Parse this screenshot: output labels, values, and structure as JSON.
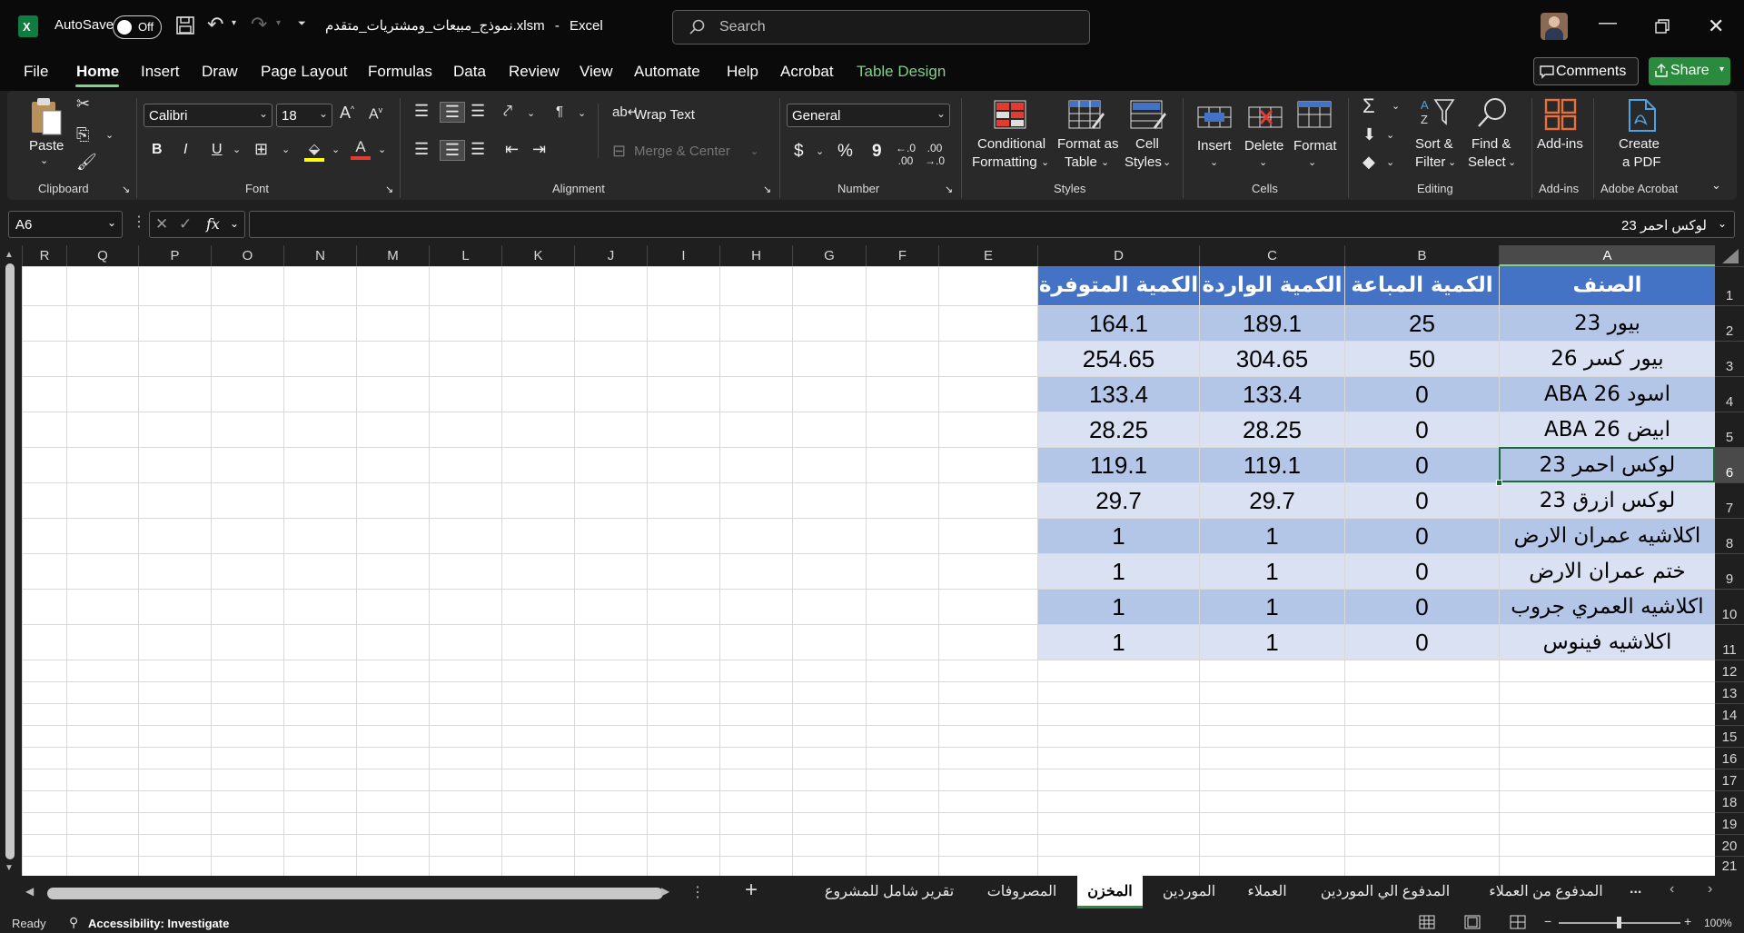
{
  "titlebar": {
    "autosave_label": "AutoSave",
    "autosave_state": "Off",
    "file_title": "نموذج_مبيعات_ومشتريات_متقدم.xlsm",
    "app_name": "Excel",
    "title_separator": "-",
    "search_placeholder": "Search"
  },
  "menu": {
    "items": [
      "File",
      "Home",
      "Insert",
      "Draw",
      "Page Layout",
      "Formulas",
      "Data",
      "Review",
      "View",
      "Automate",
      "Help",
      "Acrobat",
      "Table Design"
    ],
    "active": "Home",
    "comments_label": "Comments",
    "share_label": "Share"
  },
  "ribbon": {
    "clipboard": {
      "paste": "Paste",
      "group": "Clipboard"
    },
    "font": {
      "name": "Calibri",
      "size": "18",
      "bold": "B",
      "italic": "I",
      "underline": "U",
      "group": "Font"
    },
    "alignment": {
      "wrap": "Wrap Text",
      "merge": "Merge & Center",
      "group": "Alignment"
    },
    "number": {
      "format": "General",
      "currency": "$",
      "percent": "%",
      "comma": "9",
      "group": "Number"
    },
    "styles": {
      "cond1": "Conditional",
      "cond2": "Formatting",
      "fat1": "Format as",
      "fat2": "Table",
      "cs1": "Cell",
      "cs2": "Styles",
      "group": "Styles"
    },
    "cells": {
      "insert": "Insert",
      "delete": "Delete",
      "format": "Format",
      "group": "Cells"
    },
    "editing": {
      "sort1": "Sort &",
      "sort2": "Filter",
      "find1": "Find &",
      "find2": "Select",
      "group": "Editing"
    },
    "addins": {
      "label": "Add-ins",
      "group": "Add-ins"
    },
    "acrobat": {
      "l1": "Create",
      "l2": "a PDF",
      "group": "Adobe Acrobat"
    }
  },
  "formula_bar": {
    "name_box": "A6",
    "fx": "fx",
    "content": "لوكس احمر 23"
  },
  "columns": [
    "R",
    "Q",
    "P",
    "O",
    "N",
    "M",
    "L",
    "K",
    "J",
    "I",
    "H",
    "G",
    "F",
    "E",
    "D",
    "C",
    "B",
    "A"
  ],
  "rows": [
    "1",
    "2",
    "3",
    "4",
    "5",
    "6",
    "7",
    "8",
    "9",
    "10",
    "11",
    "12",
    "13",
    "14",
    "15",
    "16",
    "17",
    "18",
    "19",
    "20",
    "21"
  ],
  "selected_cell": {
    "column": "A",
    "row": "6"
  },
  "table": {
    "headers": {
      "A": "الصنف",
      "B": "الكمية المباعة",
      "C": "الكمية الواردة",
      "D": "الكمية المتوفرة"
    },
    "rows": [
      {
        "A": "بيور 23",
        "B": "25",
        "C": "189.1",
        "D": "164.1"
      },
      {
        "A": "بيور كسر 26",
        "B": "50",
        "C": "304.65",
        "D": "254.65"
      },
      {
        "A": "اسود ABA 26",
        "B": "0",
        "C": "133.4",
        "D": "133.4"
      },
      {
        "A": "ابيض ABA 26",
        "B": "0",
        "C": "28.25",
        "D": "28.25"
      },
      {
        "A": "لوكس احمر 23",
        "B": "0",
        "C": "119.1",
        "D": "119.1"
      },
      {
        "A": "لوكس ازرق 23",
        "B": "0",
        "C": "29.7",
        "D": "29.7"
      },
      {
        "A": "اكلاشيه عمران الارض",
        "B": "0",
        "C": "1",
        "D": "1"
      },
      {
        "A": "ختم عمران الارض",
        "B": "0",
        "C": "1",
        "D": "1"
      },
      {
        "A": "اكلاشيه العمري جروب",
        "B": "0",
        "C": "1",
        "D": "1"
      },
      {
        "A": "اكلاشيه فينوس",
        "B": "0",
        "C": "1",
        "D": "1"
      }
    ],
    "band_colors": {
      "dark": "#b4c6e7",
      "light": "#d9e1f2",
      "header": "#4472c4"
    }
  },
  "sheets": {
    "tabs": [
      "المدفوع من العملاء",
      "المدفوع الي الموردين",
      "العملاء",
      "الموردين",
      "المخزن",
      "المصروفات",
      "تقرير شامل للمشروع"
    ],
    "active": "المخزن",
    "more": "...",
    "add": "+"
  },
  "status": {
    "ready": "Ready",
    "accessibility": "Accessibility: Investigate",
    "zoom": "100%"
  },
  "colors": {
    "accent_green": "#7fd08a",
    "share_green": "#2a8a3d",
    "excel_green": "#107c41"
  }
}
